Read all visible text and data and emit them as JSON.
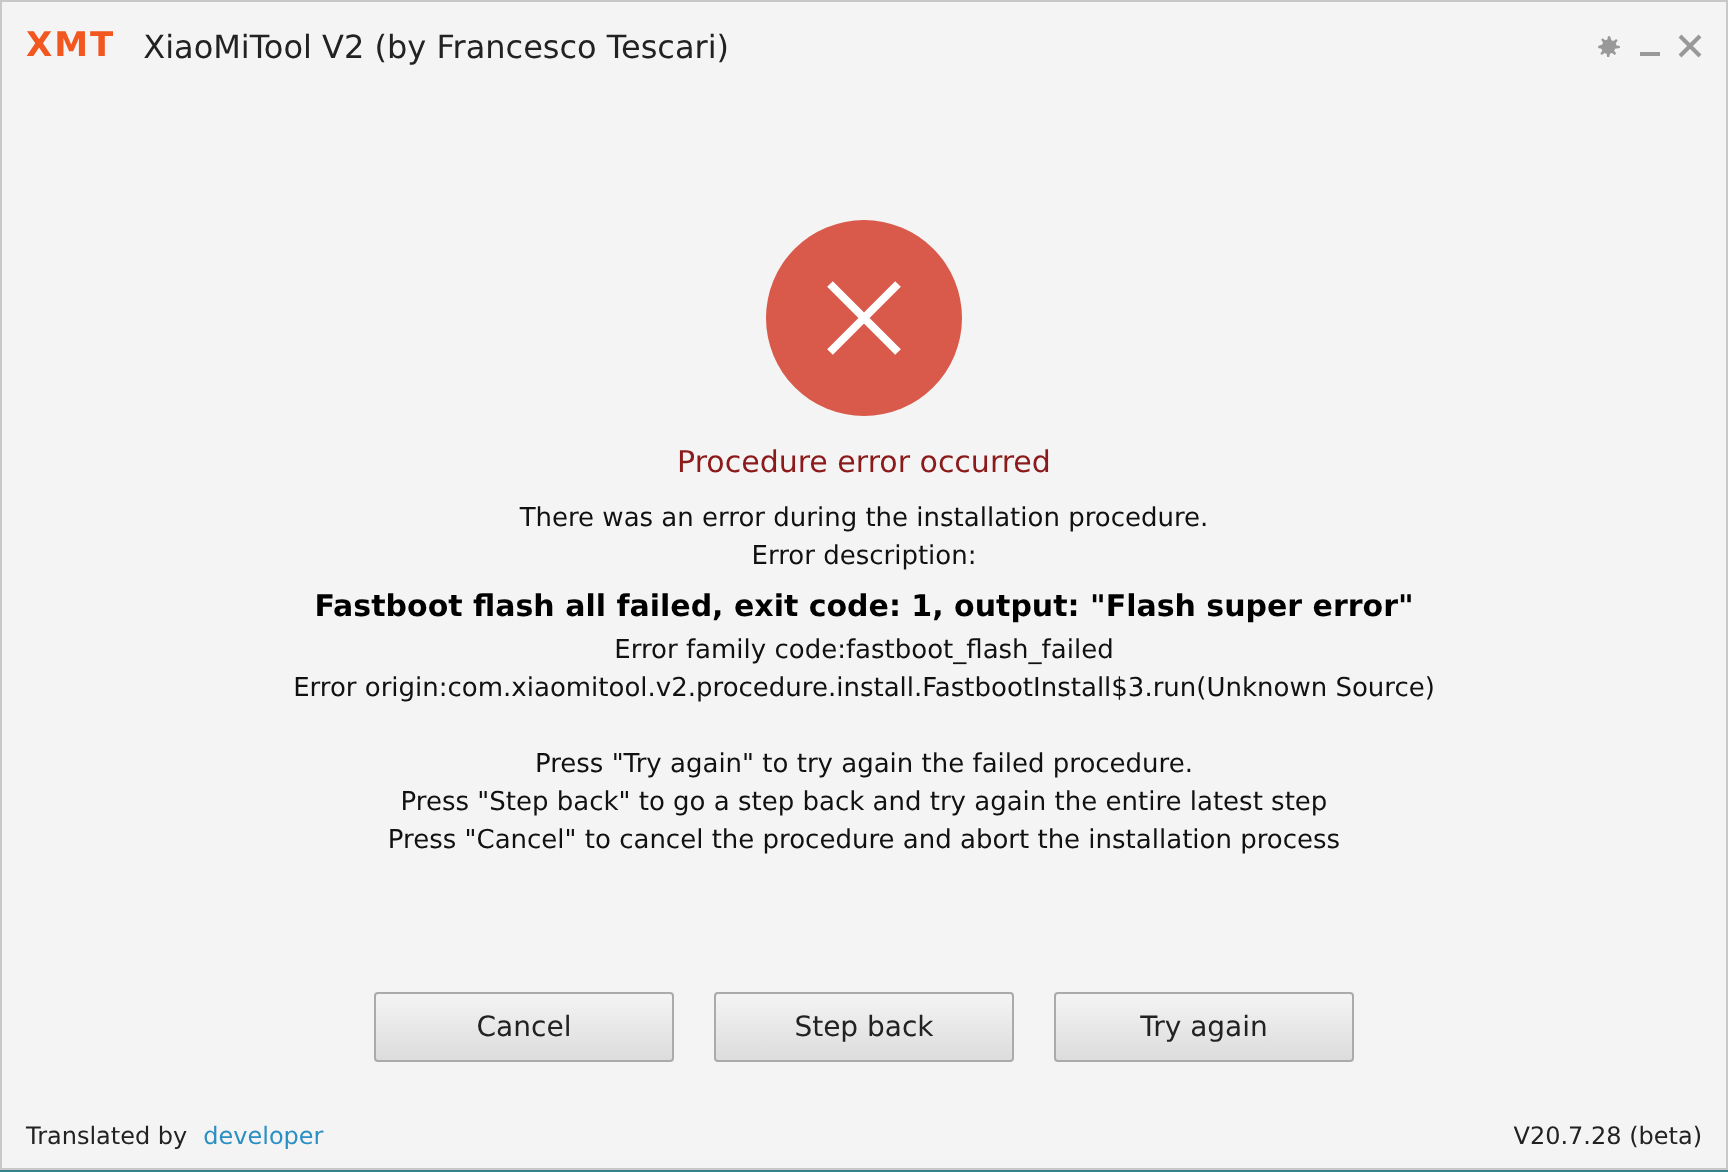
{
  "window": {
    "logo": "XMT",
    "title": "XiaoMiTool V2 (by Francesco Tescari)"
  },
  "dialog": {
    "heading": "Procedure error occurred",
    "intro": [
      "There was an error during the installation procedure.",
      "Error description:"
    ],
    "error": "Fastboot flash all failed, exit code: 1, output: \"Flash super error\"",
    "details": [
      "Error family code:fastboot_flash_failed",
      "Error origin:com.xiaomitool.v2.procedure.install.FastbootInstall$3.run(Unknown Source)"
    ],
    "instructions": [
      "Press \"Try again\" to try again the failed procedure.",
      "Press \"Step back\" to go a step back and try again the entire latest step",
      "Press \"Cancel\" to cancel the procedure and abort the installation process"
    ],
    "buttons": [
      "Cancel",
      "Step back",
      "Try again"
    ]
  },
  "footer": {
    "translated_by": "Translated by",
    "translator": "developer",
    "version": "V20.7.28 (beta)"
  }
}
